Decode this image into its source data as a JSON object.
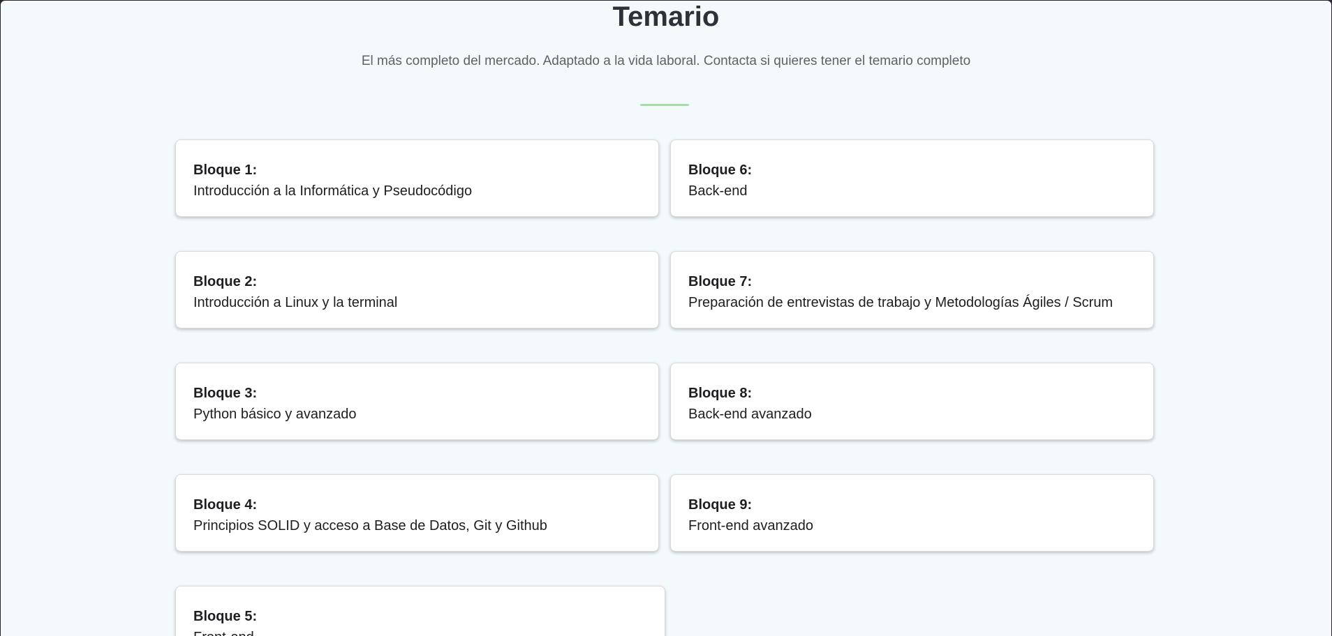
{
  "header": {
    "title": "Temario",
    "subtitle": "El más completo del mercado. Adaptado a la vida laboral. Contacta si quieres tener el temario completo"
  },
  "colors": {
    "background": "#f4f9fc",
    "divider": "#a8dca6",
    "card": "#ffffff",
    "title": "#2e3238"
  },
  "blocks": [
    {
      "label": "Bloque 1:",
      "text": "Introducción a la Informática y Pseudocódigo"
    },
    {
      "label": "Bloque 2:",
      "text": "Introducción a Linux y la terminal"
    },
    {
      "label": "Bloque 3:",
      "text": "Python básico y avanzado"
    },
    {
      "label": "Bloque 4:",
      "text": "Principios SOLID y acceso a Base de Datos, Git y Github"
    },
    {
      "label": "Bloque 5:",
      "text": "Front-end"
    },
    {
      "label": "Bloque 6:",
      "text": "Back-end"
    },
    {
      "label": "Bloque 7:",
      "text": "Preparación de entrevistas de trabajo y Metodologías Ágiles / Scrum"
    },
    {
      "label": "Bloque 8:",
      "text": "Back-end avanzado"
    },
    {
      "label": "Bloque 9:",
      "text": "Front-end avanzado"
    }
  ]
}
